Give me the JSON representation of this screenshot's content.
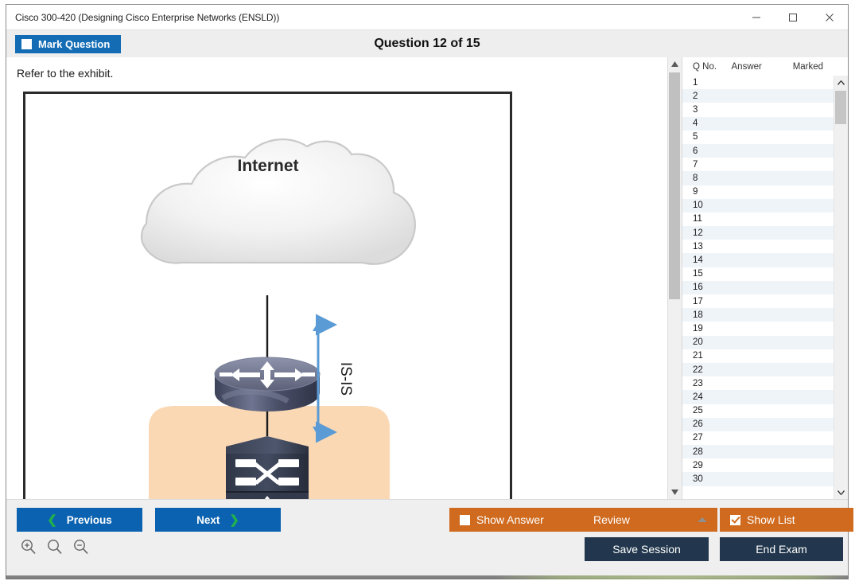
{
  "window": {
    "title": "Cisco 300-420 (Designing Cisco Enterprise Networks (ENSLD))",
    "minimize_label": "minimize-icon",
    "maximize_label": "maximize-icon",
    "close_label": "close-icon"
  },
  "header": {
    "mark_question_label": "Mark Question",
    "mark_question_checked": false,
    "question_counter": "Question 12 of 15"
  },
  "content": {
    "refer_text": "Refer to the exhibit.",
    "exhibit": {
      "cloud_label": "Internet",
      "protocol_label": "IS-IS",
      "nodes": [
        {
          "type": "cloud",
          "label": "Internet"
        },
        {
          "type": "router",
          "label": ""
        },
        {
          "type": "switch",
          "label": ""
        }
      ],
      "region_color": "#fad8b4",
      "arrow_color": "#5b9bd5"
    }
  },
  "list": {
    "columns": [
      "Q No.",
      "Answer",
      "Marked"
    ],
    "rows": [
      {
        "qno": "1",
        "answer": "",
        "marked": ""
      },
      {
        "qno": "2",
        "answer": "",
        "marked": ""
      },
      {
        "qno": "3",
        "answer": "",
        "marked": ""
      },
      {
        "qno": "4",
        "answer": "",
        "marked": ""
      },
      {
        "qno": "5",
        "answer": "",
        "marked": ""
      },
      {
        "qno": "6",
        "answer": "",
        "marked": ""
      },
      {
        "qno": "7",
        "answer": "",
        "marked": ""
      },
      {
        "qno": "8",
        "answer": "",
        "marked": ""
      },
      {
        "qno": "9",
        "answer": "",
        "marked": ""
      },
      {
        "qno": "10",
        "answer": "",
        "marked": ""
      },
      {
        "qno": "11",
        "answer": "",
        "marked": ""
      },
      {
        "qno": "12",
        "answer": "",
        "marked": ""
      },
      {
        "qno": "13",
        "answer": "",
        "marked": ""
      },
      {
        "qno": "14",
        "answer": "",
        "marked": ""
      },
      {
        "qno": "15",
        "answer": "",
        "marked": ""
      },
      {
        "qno": "16",
        "answer": "",
        "marked": ""
      },
      {
        "qno": "17",
        "answer": "",
        "marked": ""
      },
      {
        "qno": "18",
        "answer": "",
        "marked": ""
      },
      {
        "qno": "19",
        "answer": "",
        "marked": ""
      },
      {
        "qno": "20",
        "answer": "",
        "marked": ""
      },
      {
        "qno": "21",
        "answer": "",
        "marked": ""
      },
      {
        "qno": "22",
        "answer": "",
        "marked": ""
      },
      {
        "qno": "23",
        "answer": "",
        "marked": ""
      },
      {
        "qno": "24",
        "answer": "",
        "marked": ""
      },
      {
        "qno": "25",
        "answer": "",
        "marked": ""
      },
      {
        "qno": "26",
        "answer": "",
        "marked": ""
      },
      {
        "qno": "27",
        "answer": "",
        "marked": ""
      },
      {
        "qno": "28",
        "answer": "",
        "marked": ""
      },
      {
        "qno": "29",
        "answer": "",
        "marked": ""
      },
      {
        "qno": "30",
        "answer": "",
        "marked": ""
      }
    ]
  },
  "footer": {
    "previous_label": "Previous",
    "previous_chevron": "❮",
    "next_label": "Next",
    "next_chevron": "❯",
    "show_answer_label": "Show Answer",
    "show_answer_checked": false,
    "review_label": "Review",
    "show_list_label": "Show List",
    "show_list_checked": true,
    "save_session_label": "Save Session",
    "end_exam_label": "End Exam",
    "zoom_icons": [
      "zoom-in-icon",
      "zoom-reset-icon",
      "zoom-out-icon"
    ]
  },
  "colors": {
    "accent_blue": "#0b62b0",
    "accent_orange": "#cf6a1e",
    "accent_navy": "#22374d",
    "chevron_green": "#22b14c"
  }
}
